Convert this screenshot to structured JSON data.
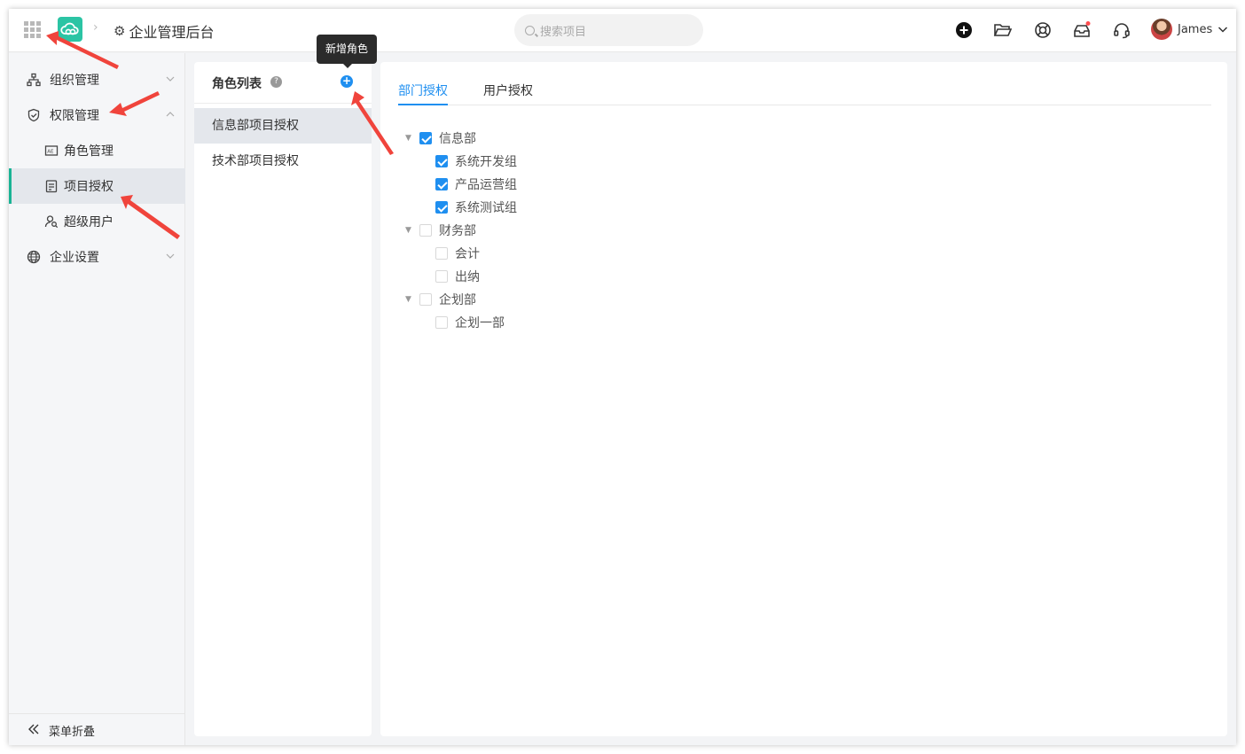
{
  "header": {
    "app_title": "企业管理后台",
    "search_placeholder": "搜索项目",
    "user_name": "James",
    "icons": [
      "apps-grid-icon",
      "cloud-logo-icon",
      "gear-icon",
      "plus-circle-icon",
      "folder-open-icon",
      "lifebuoy-icon",
      "inbox-icon",
      "headset-icon",
      "chevron-down-icon"
    ],
    "notification_dot_color": "#ff4d4f"
  },
  "sidebar": {
    "items": [
      {
        "label": "组织管理",
        "icon": "org-chart-icon",
        "expanded": false
      },
      {
        "label": "权限管理",
        "icon": "shield-icon",
        "expanded": true
      },
      {
        "label": "角色管理",
        "icon": "id-card-icon"
      },
      {
        "label": "项目授权",
        "icon": "clipboard-icon",
        "active": true
      },
      {
        "label": "超级用户",
        "icon": "user-search-icon"
      },
      {
        "label": "企业设置",
        "icon": "globe-icon",
        "expanded": false
      }
    ],
    "collapse_label": "菜单折叠"
  },
  "roles": {
    "title": "角色列表",
    "tooltip": "新增角色",
    "items": [
      {
        "label": "信息部项目授权",
        "selected": true
      },
      {
        "label": "技术部项目授权",
        "selected": false
      }
    ]
  },
  "tabs": [
    {
      "label": "部门授权",
      "active": true
    },
    {
      "label": "用户授权",
      "active": false
    }
  ],
  "tree": [
    {
      "label": "信息部",
      "checked": true,
      "children": [
        {
          "label": "系统开发组",
          "checked": true
        },
        {
          "label": "产品运营组",
          "checked": true
        },
        {
          "label": "系统测试组",
          "checked": true
        }
      ]
    },
    {
      "label": "财务部",
      "checked": false,
      "children": [
        {
          "label": "会计",
          "checked": false
        },
        {
          "label": "出纳",
          "checked": false
        }
      ]
    },
    {
      "label": "企划部",
      "checked": false,
      "children": [
        {
          "label": "企划一部",
          "checked": false
        }
      ]
    }
  ],
  "colors": {
    "accent": "#1f8ff0",
    "active_marker": "#19b394",
    "logo": "#2bc4a4",
    "annotation": "#f0443c"
  }
}
